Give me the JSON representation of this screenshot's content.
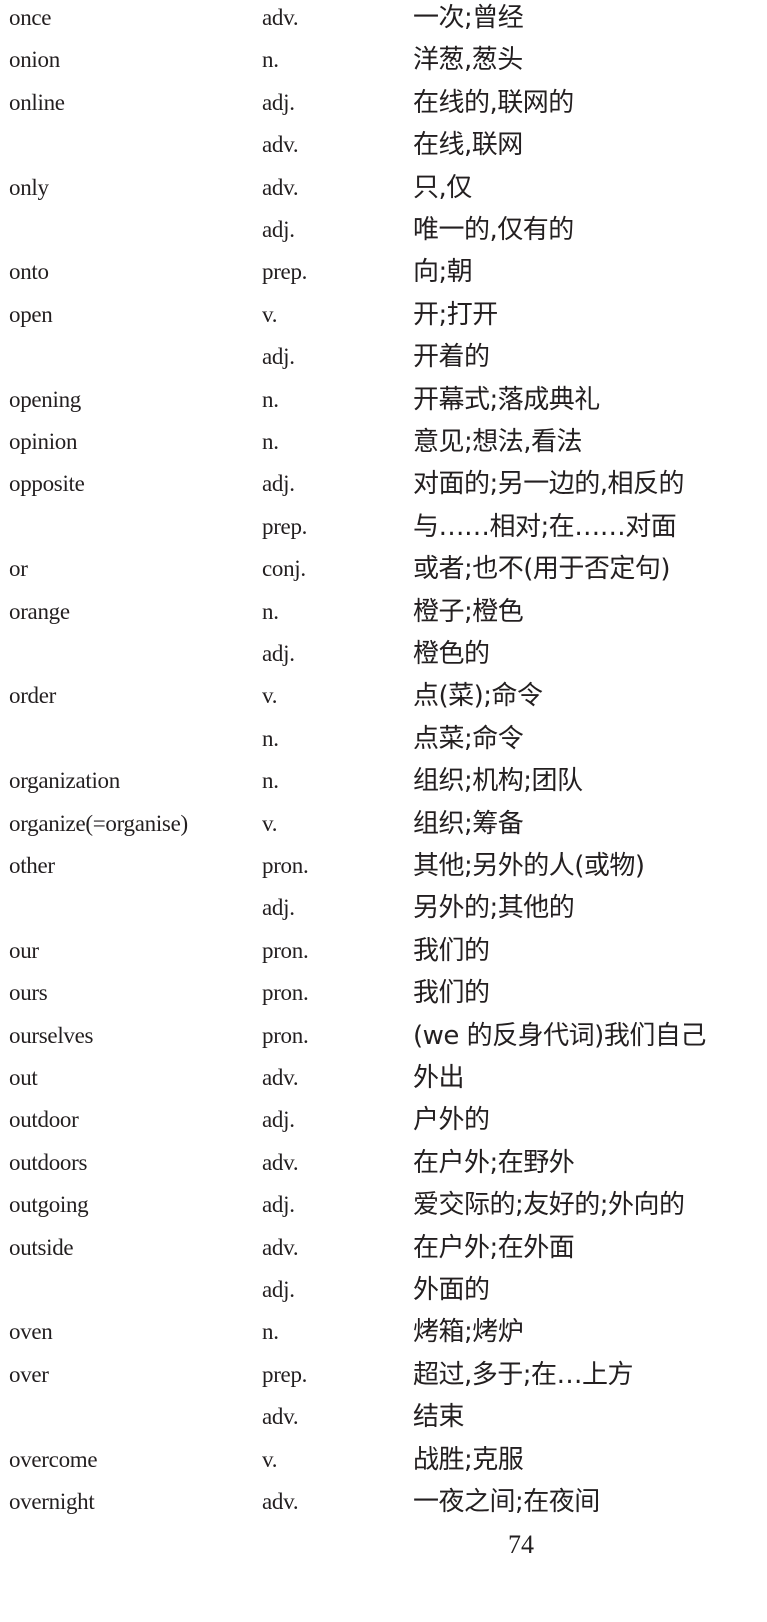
{
  "entries": [
    {
      "word": "once",
      "pos": "adv.",
      "meaning": "一次;曾经"
    },
    {
      "word": "onion",
      "pos": "n.",
      "meaning": "洋葱,葱头"
    },
    {
      "word": "online",
      "pos": "adj.",
      "meaning": "在线的,联网的"
    },
    {
      "word": "",
      "pos": "adv.",
      "meaning": "在线,联网"
    },
    {
      "word": "only",
      "pos": "adv.",
      "meaning": "只,仅"
    },
    {
      "word": "",
      "pos": "adj.",
      "meaning": "唯一的,仅有的"
    },
    {
      "word": "onto",
      "pos": "prep.",
      "meaning": "向;朝"
    },
    {
      "word": "open",
      "pos": "v.",
      "meaning": "开;打开"
    },
    {
      "word": "",
      "pos": "adj.",
      "meaning": "开着的"
    },
    {
      "word": "opening",
      "pos": "n.",
      "meaning": "开幕式;落成典礼"
    },
    {
      "word": "opinion",
      "pos": "n.",
      "meaning": "意见;想法,看法"
    },
    {
      "word": "opposite",
      "pos": "adj.",
      "meaning": "对面的;另一边的,相反的"
    },
    {
      "word": "",
      "pos": "prep.",
      "meaning": "与……相对;在……对面"
    },
    {
      "word": "or",
      "pos": "conj.",
      "meaning": "或者;也不(用于否定句)"
    },
    {
      "word": "orange",
      "pos": "n.",
      "meaning": "橙子;橙色"
    },
    {
      "word": "",
      "pos": "adj.",
      "meaning": "橙色的"
    },
    {
      "word": "order",
      "pos": "v.",
      "meaning": "点(菜);命令"
    },
    {
      "word": "",
      "pos": "n.",
      "meaning": "点菜;命令"
    },
    {
      "word": "organization",
      "pos": "n.",
      "meaning": "组织;机构;团队"
    },
    {
      "word": "organize(=organise)",
      "pos": "v.",
      "meaning": "组织;筹备"
    },
    {
      "word": "other",
      "pos": "pron.",
      "meaning": "其他;另外的人(或物)"
    },
    {
      "word": "",
      "pos": "adj.",
      "meaning": "另外的;其他的"
    },
    {
      "word": "our",
      "pos": "pron.",
      "meaning": "我们的"
    },
    {
      "word": "ours",
      "pos": "pron.",
      "meaning": "我们的"
    },
    {
      "word": "ourselves",
      "pos": "pron.",
      "meaning": "(we 的反身代词)我们自己"
    },
    {
      "word": "out",
      "pos": "adv.",
      "meaning": "外出"
    },
    {
      "word": "outdoor",
      "pos": "adj.",
      "meaning": "户外的"
    },
    {
      "word": "outdoors",
      "pos": "adv.",
      "meaning": "在户外;在野外"
    },
    {
      "word": "outgoing",
      "pos": "adj.",
      "meaning": "爱交际的;友好的;外向的"
    },
    {
      "word": "outside",
      "pos": "adv.",
      "meaning": "在户外;在外面"
    },
    {
      "word": "",
      "pos": "adj.",
      "meaning": "外面的"
    },
    {
      "word": "oven",
      "pos": "n.",
      "meaning": "烤箱;烤炉"
    },
    {
      "word": "over",
      "pos": "prep.",
      "meaning": "超过,多于;在…上方"
    },
    {
      "word": "",
      "pos": "adv.",
      "meaning": "结束"
    },
    {
      "word": "overcome",
      "pos": "v.",
      "meaning": "战胜;克服"
    },
    {
      "word": "overnight",
      "pos": "adv.",
      "meaning": "一夜之间;在夜间"
    }
  ],
  "page_number": "74"
}
